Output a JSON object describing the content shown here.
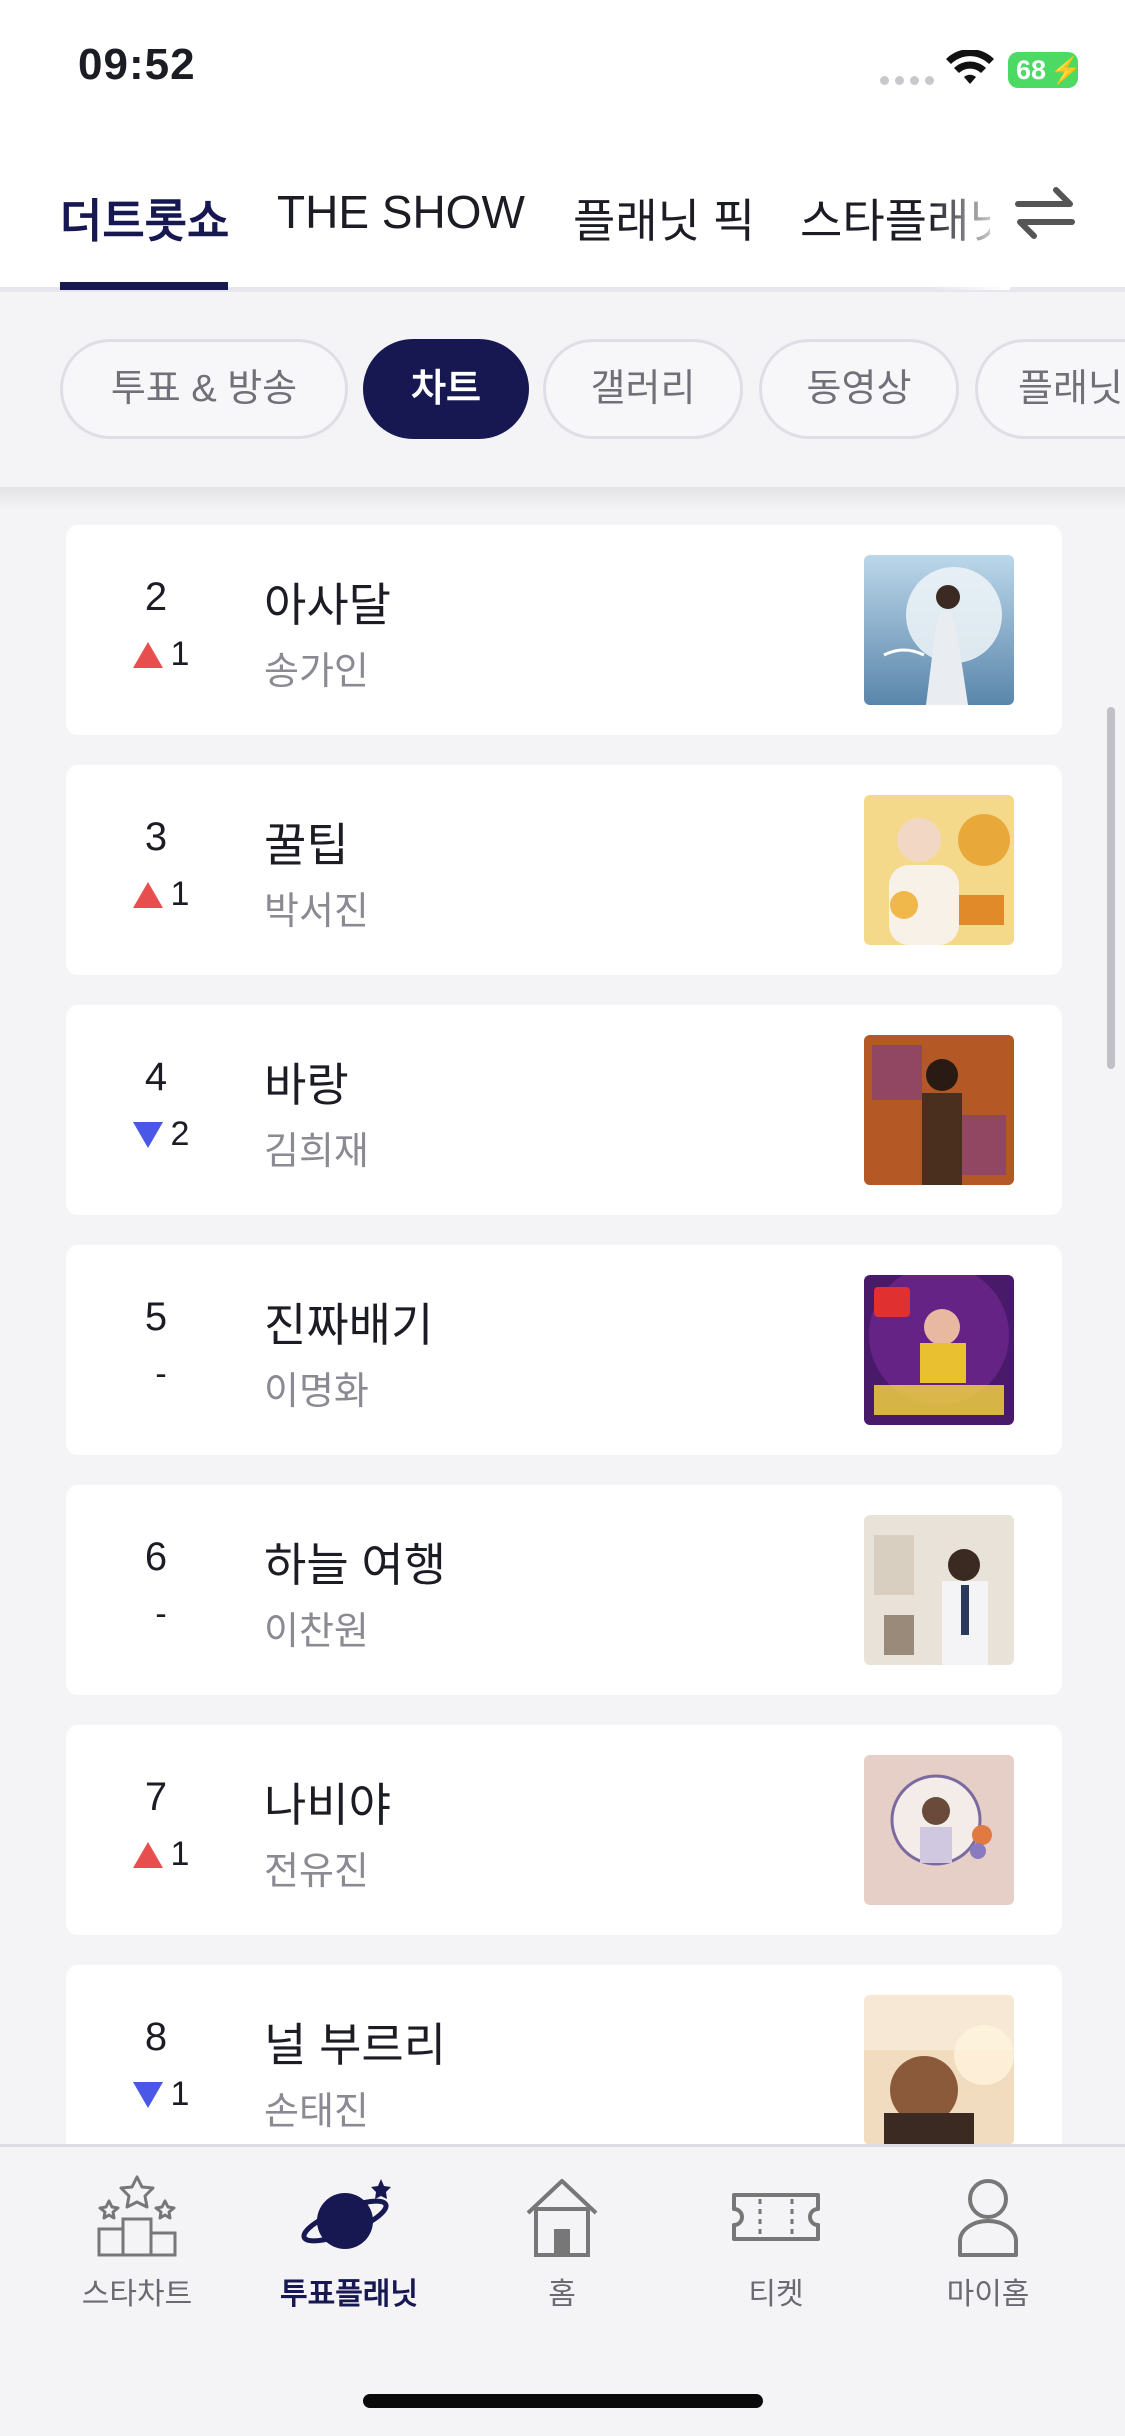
{
  "status_bar": {
    "time": "09:52",
    "battery": "68",
    "icons": [
      "signal-dots-icon",
      "wifi-icon",
      "battery-icon",
      "charging-bolt-icon"
    ]
  },
  "top_tabs": {
    "items": [
      {
        "label": "더트롯쇼",
        "active": true
      },
      {
        "label": "THE SHOW",
        "active": false
      },
      {
        "label": "플래닛 픽",
        "active": false
      },
      {
        "label": "스타플래닛",
        "active": false
      }
    ],
    "swap_icon": "swap-arrows-icon"
  },
  "chips": [
    {
      "label": "투표 & 방송",
      "active": false
    },
    {
      "label": "차트",
      "active": true
    },
    {
      "label": "갤러리",
      "active": false
    },
    {
      "label": "동영상",
      "active": false
    },
    {
      "label": "플래닛",
      "active": false
    }
  ],
  "chart_list": [
    {
      "rank": "2",
      "change": "1",
      "direction": "up",
      "title": "아사달",
      "artist": "송가인"
    },
    {
      "rank": "3",
      "change": "1",
      "direction": "up",
      "title": "꿀팁",
      "artist": "박서진"
    },
    {
      "rank": "4",
      "change": "2",
      "direction": "down",
      "title": "바랑",
      "artist": "김희재"
    },
    {
      "rank": "5",
      "change": "-",
      "direction": "none",
      "title": "진짜배기",
      "artist": "이명화"
    },
    {
      "rank": "6",
      "change": "-",
      "direction": "none",
      "title": "하늘 여행",
      "artist": "이찬원"
    },
    {
      "rank": "7",
      "change": "1",
      "direction": "up",
      "title": "나비야",
      "artist": "전유진"
    },
    {
      "rank": "8",
      "change": "1",
      "direction": "down",
      "title": "널 부르리",
      "artist": "손태진"
    }
  ],
  "colors": {
    "brand_navy": "#171852",
    "up": "#e94e4e",
    "down": "#4a58e8",
    "background": "#f4f4f7"
  },
  "bottom_nav": [
    {
      "label": "스타차트",
      "icon": "star-podium-icon",
      "active": false
    },
    {
      "label": "투표플래닛",
      "icon": "planet-icon",
      "active": true
    },
    {
      "label": "홈",
      "icon": "home-icon",
      "active": false
    },
    {
      "label": "티켓",
      "icon": "ticket-icon",
      "active": false
    },
    {
      "label": "마이홈",
      "icon": "person-icon",
      "active": false
    }
  ]
}
